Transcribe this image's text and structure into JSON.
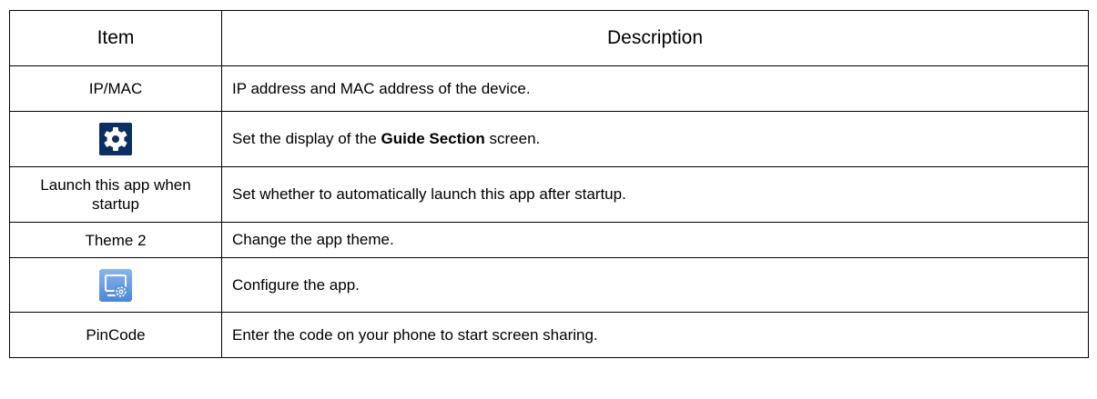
{
  "table": {
    "headers": {
      "item": "Item",
      "description": "Description"
    },
    "rows": [
      {
        "item": "IP/MAC",
        "description": "IP address and MAC address of the device."
      },
      {
        "item_icon": "gear-icon",
        "description_before": "Set the display of the ",
        "description_bold": "Guide Section",
        "description_after": " screen."
      },
      {
        "item": "Launch this app when startup",
        "description": "Set whether to automatically launch this app after startup."
      },
      {
        "item": "Theme 2",
        "description": "Change the app theme."
      },
      {
        "item_icon": "screen-settings-icon",
        "description": "Configure the app."
      },
      {
        "item": "PinCode",
        "description": "Enter the code on your phone to start screen sharing."
      }
    ]
  },
  "colors": {
    "gear_icon_background": "#0a2f63",
    "config_icon_background": "#5b93e0",
    "border": "#000000"
  }
}
